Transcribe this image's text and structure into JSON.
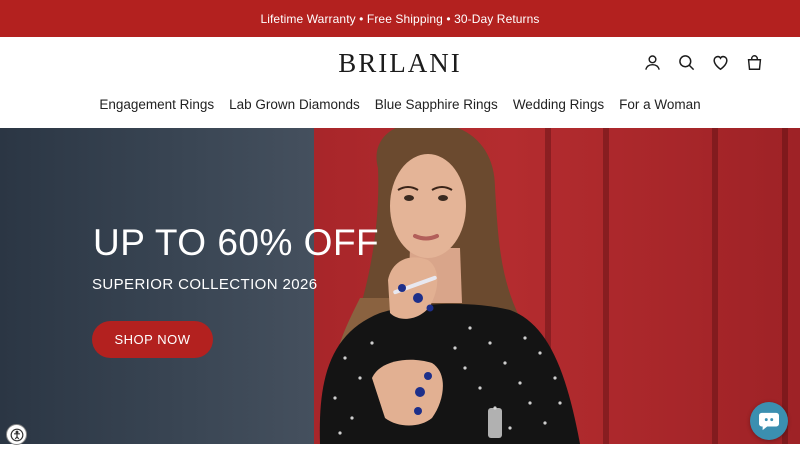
{
  "announcement": {
    "text": "Lifetime Warranty • Free Shipping • 30-Day Returns"
  },
  "header": {
    "logo": "BRILANI",
    "icons": [
      "account-icon",
      "search-icon",
      "heart-icon",
      "bag-icon"
    ]
  },
  "nav": {
    "items": [
      {
        "label": "Engagement Rings"
      },
      {
        "label": "Lab Grown Diamonds"
      },
      {
        "label": "Blue Sapphire Rings"
      },
      {
        "label": "Wedding Rings"
      },
      {
        "label": "For a Woman"
      }
    ]
  },
  "hero": {
    "headline": "UP TO 60% OFF",
    "subhead": "SUPERIOR COLLECTION 2026",
    "cta_label": "SHOP NOW"
  },
  "colors": {
    "brand_red": "#b3211f",
    "chat_blue": "#3b8fb0",
    "hero_left": "#36414f",
    "hero_right": "#ab282b"
  },
  "widgets": {
    "accessibility_icon": "accessibility-icon",
    "chat_icon": "chat-icon"
  }
}
